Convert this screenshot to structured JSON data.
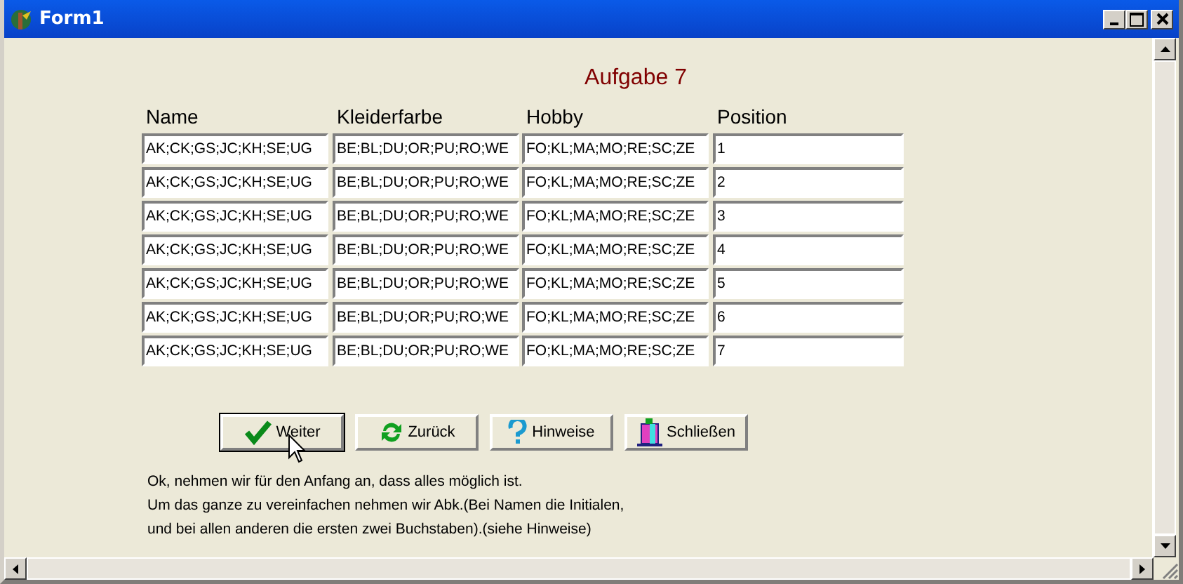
{
  "window": {
    "title": "Form1"
  },
  "heading": "Aufgabe 7",
  "columns": [
    "Name",
    "Kleiderfarbe",
    "Hobby",
    "Position"
  ],
  "rows": [
    [
      "AK;CK;GS;JC;KH;SE;UG",
      "BE;BL;DU;OR;PU;RO;WE",
      "FO;KL;MA;MO;RE;SC;ZE",
      "1"
    ],
    [
      "AK;CK;GS;JC;KH;SE;UG",
      "BE;BL;DU;OR;PU;RO;WE",
      "FO;KL;MA;MO;RE;SC;ZE",
      "2"
    ],
    [
      "AK;CK;GS;JC;KH;SE;UG",
      "BE;BL;DU;OR;PU;RO;WE",
      "FO;KL;MA;MO;RE;SC;ZE",
      "3"
    ],
    [
      "AK;CK;GS;JC;KH;SE;UG",
      "BE;BL;DU;OR;PU;RO;WE",
      "FO;KL;MA;MO;RE;SC;ZE",
      "4"
    ],
    [
      "AK;CK;GS;JC;KH;SE;UG",
      "BE;BL;DU;OR;PU;RO;WE",
      "FO;KL;MA;MO;RE;SC;ZE",
      "5"
    ],
    [
      "AK;CK;GS;JC;KH;SE;UG",
      "BE;BL;DU;OR;PU;RO;WE",
      "FO;KL;MA;MO;RE;SC;ZE",
      "6"
    ],
    [
      "AK;CK;GS;JC;KH;SE;UG",
      "BE;BL;DU;OR;PU;RO;WE",
      "FO;KL;MA;MO;RE;SC;ZE",
      "7"
    ]
  ],
  "buttons": [
    {
      "label": "Weiter",
      "kind": "check",
      "focused": true
    },
    {
      "label": "Zurück",
      "kind": "refresh",
      "focused": false
    },
    {
      "label": "Hinweise",
      "kind": "help",
      "focused": false
    },
    {
      "label": "Schließen",
      "kind": "exit",
      "focused": false
    }
  ],
  "notes": [
    "Ok, nehmen wir für den Anfang an, dass alles möglich ist.",
    "Um das ganze zu vereinfachen nehmen wir Abk.(Bei Namen die Initialen,",
    "und bei allen anderen die ersten zwei Buchstaben).(siehe Hinweise)"
  ]
}
